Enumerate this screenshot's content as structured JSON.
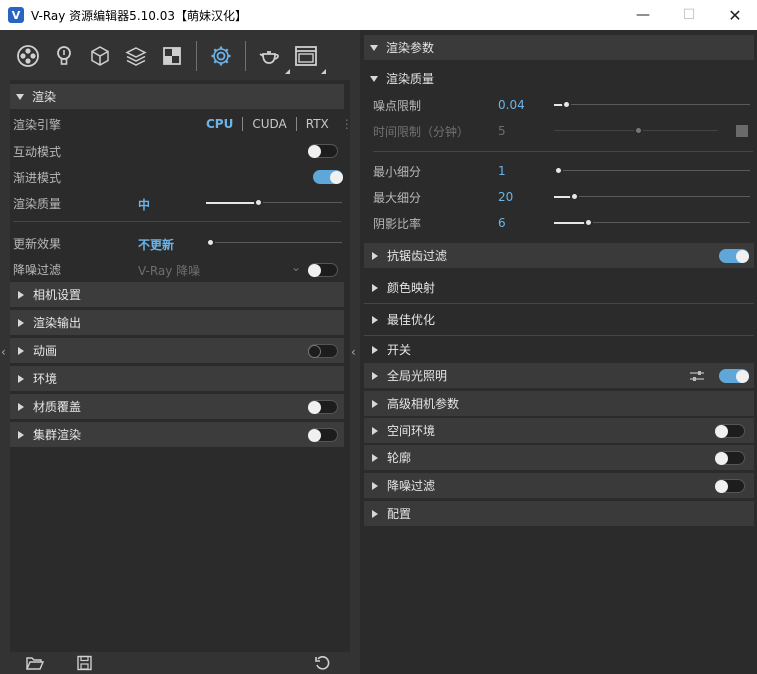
{
  "window": {
    "title": "V-Ray 资源编辑器5.10.03【萌妹汉化】",
    "min_label": "—",
    "max_label": "☐",
    "close_label": "✕"
  },
  "toolbar": {
    "icons": [
      "render-elements-icon",
      "lights-icon",
      "geometry-icon",
      "layers-icon",
      "textures-icon",
      "settings-icon",
      "render-teapot-icon",
      "frame-buffer-icon"
    ]
  },
  "left": {
    "render_section": {
      "title": "渲染",
      "engine_label": "渲染引擎",
      "engine_options": [
        "CPU",
        "CUDA",
        "RTX"
      ],
      "engine_selected": "CPU",
      "interactive_label": "互动模式",
      "interactive_on": false,
      "progressive_label": "渐进模式",
      "progressive_on": true,
      "quality_label": "渲染质量",
      "quality_value": "中",
      "quality_level": 0.77,
      "update_label": "更新效果",
      "update_value": "不更新",
      "update_level": 0.0,
      "denoise_label": "降噪过滤",
      "denoise_value": "V-Ray 降噪",
      "denoise_on": false
    },
    "sections": [
      {
        "title": "相机设置",
        "toggle": null
      },
      {
        "title": "渲染输出",
        "toggle": null
      },
      {
        "title": "动画",
        "toggle": "off"
      },
      {
        "title": "环境",
        "toggle": null
      },
      {
        "title": "材质覆盖",
        "toggle": "off"
      },
      {
        "title": "集群渲染",
        "toggle": "off"
      }
    ]
  },
  "right": {
    "header": "渲染参数",
    "quality_section": {
      "title": "渲染质量",
      "noise_label": "噪点限制",
      "noise_value": "0.04",
      "time_label": "时间限制（分钟）",
      "time_value": "5",
      "min_sub_label": "最小细分",
      "min_sub_value": "1",
      "max_sub_label": "最大细分",
      "max_sub_value": "20",
      "shadow_label": "阴影比率",
      "shadow_value": "6"
    },
    "sections": [
      {
        "title": "抗锯齿过滤",
        "toggle": "on"
      },
      {
        "title": "颜色映射",
        "toggle": null
      },
      {
        "title": "最佳优化",
        "toggle": null
      },
      {
        "title": "开关",
        "toggle": null
      },
      {
        "title": "全局光照明",
        "toggle": "on"
      },
      {
        "title": "高级相机参数",
        "toggle": null
      },
      {
        "title": "空间环境",
        "toggle": "off"
      },
      {
        "title": "轮廓",
        "toggle": "off"
      },
      {
        "title": "降噪过滤",
        "toggle": "off"
      },
      {
        "title": "配置",
        "toggle": null
      }
    ]
  }
}
